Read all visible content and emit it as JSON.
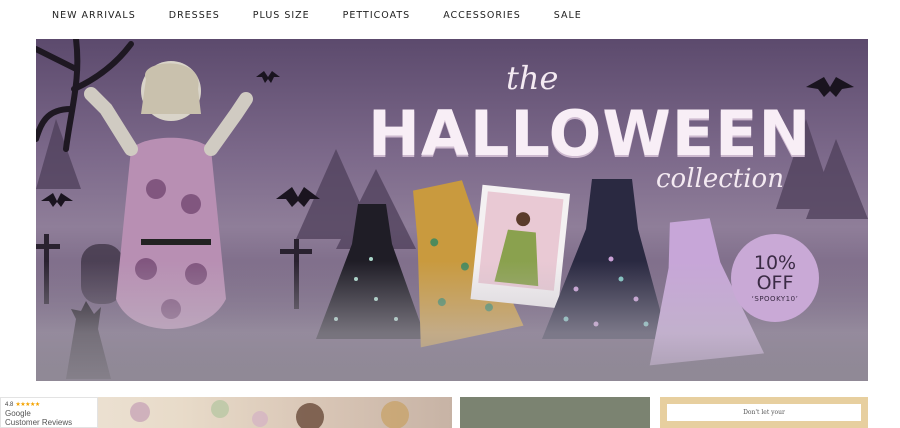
{
  "nav": {
    "items": [
      {
        "label": "NEW ARRIVALS"
      },
      {
        "label": "DRESSES"
      },
      {
        "label": "PLUS SIZE"
      },
      {
        "label": "PETTICOATS"
      },
      {
        "label": "ACCESSORIES"
      },
      {
        "label": "SALE"
      }
    ]
  },
  "hero": {
    "title_the": "the",
    "title_main": "HALLOWEEN",
    "title_collection": "collection",
    "discount": {
      "percent": "10%",
      "off": "OFF",
      "code": "‘SPOOKY10’"
    }
  },
  "reviews_badge": {
    "rating": "4.8",
    "stars": "★★★★★",
    "provider": "Google",
    "label": "Customer Reviews"
  },
  "tiles": {
    "third_text": "Don't let your"
  },
  "colors": {
    "accent": "#c9a9d6",
    "hero_bg": "#7d6a8b",
    "star": "#f4a300"
  }
}
